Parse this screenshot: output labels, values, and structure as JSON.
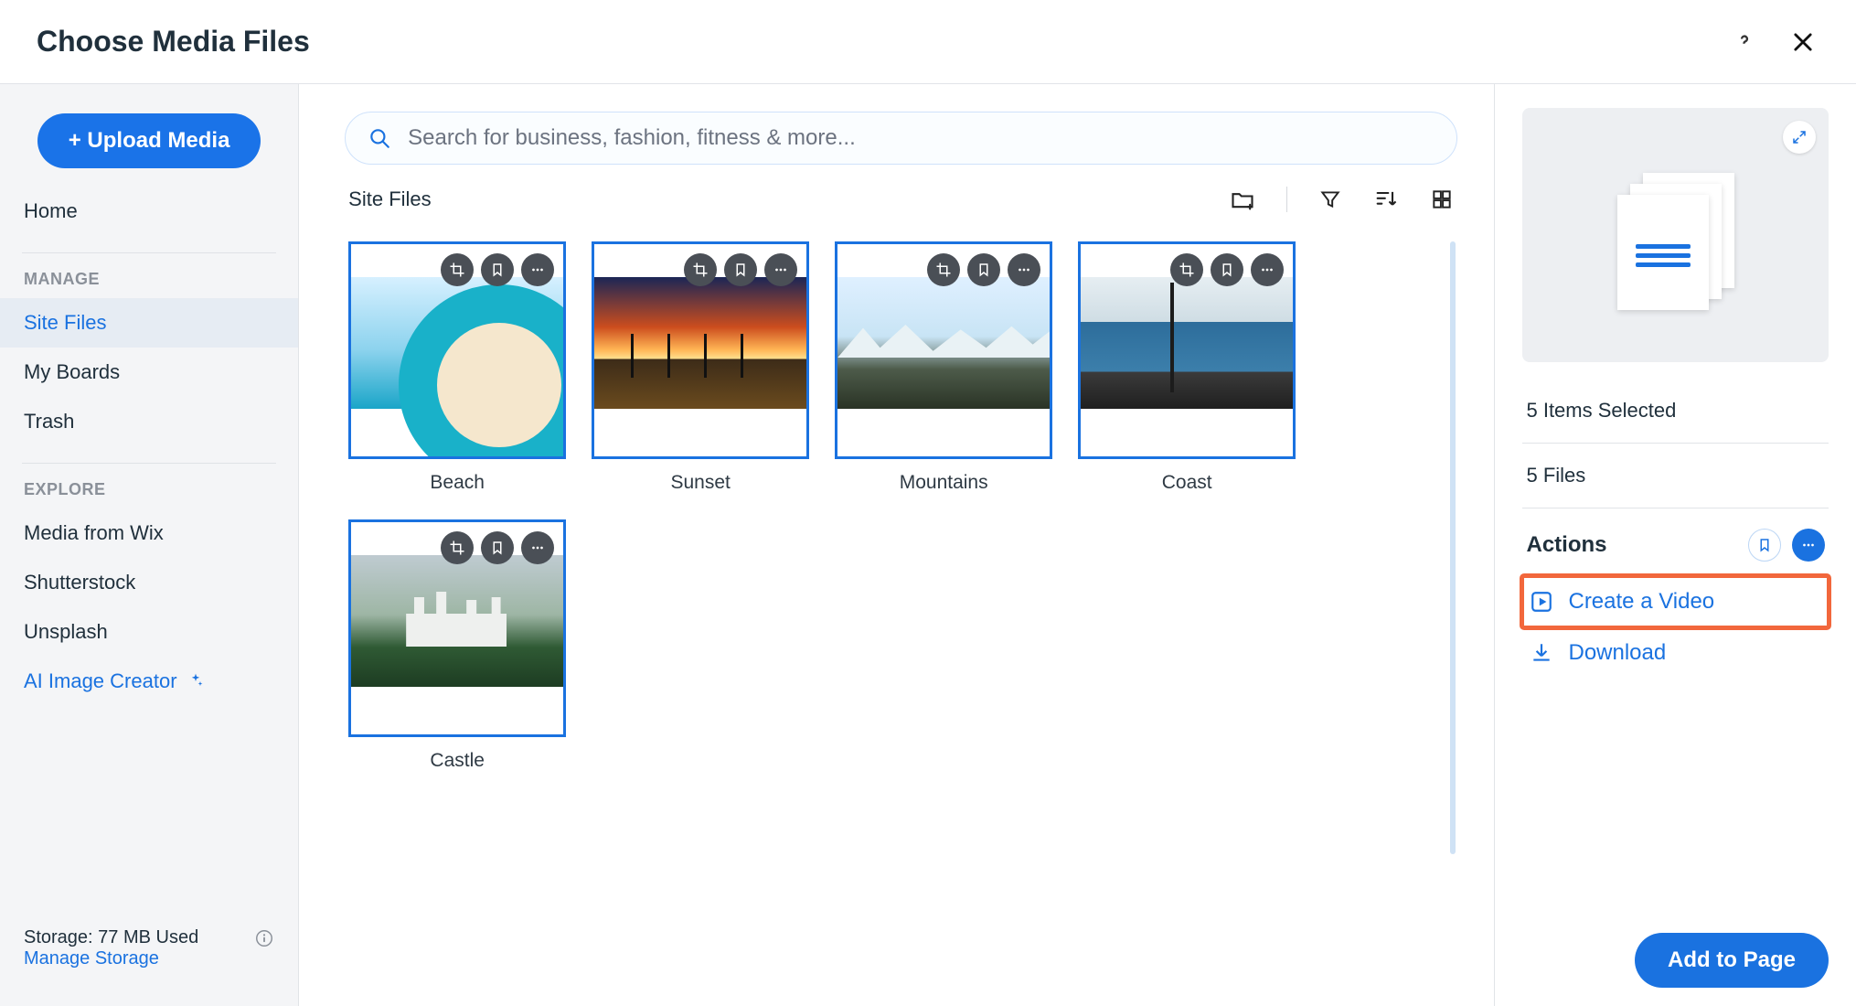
{
  "header": {
    "title": "Choose Media Files"
  },
  "sidebar": {
    "upload_label": "+ Upload Media",
    "home_label": "Home",
    "manage_label": "MANAGE",
    "manage_items": [
      {
        "label": "Site Files",
        "active": true
      },
      {
        "label": "My Boards",
        "active": false
      },
      {
        "label": "Trash",
        "active": false
      }
    ],
    "explore_label": "EXPLORE",
    "explore_items": [
      {
        "label": "Media from Wix"
      },
      {
        "label": "Shutterstock"
      },
      {
        "label": "Unsplash"
      }
    ],
    "ai_label": "AI Image Creator",
    "storage_text": "Storage: 77 MB Used",
    "manage_storage_label": "Manage Storage"
  },
  "search": {
    "placeholder": "Search for business, fashion, fitness & more..."
  },
  "toolbar": {
    "breadcrumb": "Site Files"
  },
  "files": [
    {
      "label": "Beach",
      "thumb_kind": "beach"
    },
    {
      "label": "Sunset",
      "thumb_kind": "sunset"
    },
    {
      "label": "Mountains",
      "thumb_kind": "mountains"
    },
    {
      "label": "Coast",
      "thumb_kind": "coast"
    },
    {
      "label": "Castle",
      "thumb_kind": "castle"
    }
  ],
  "panel": {
    "selected_text": "5 Items Selected",
    "files_text": "5 Files",
    "actions_label": "Actions",
    "create_video_label": "Create a Video",
    "download_label": "Download"
  },
  "footer": {
    "add_to_page_label": "Add to Page"
  },
  "colors": {
    "accent": "#1a72e0",
    "highlight": "#f2673c"
  }
}
